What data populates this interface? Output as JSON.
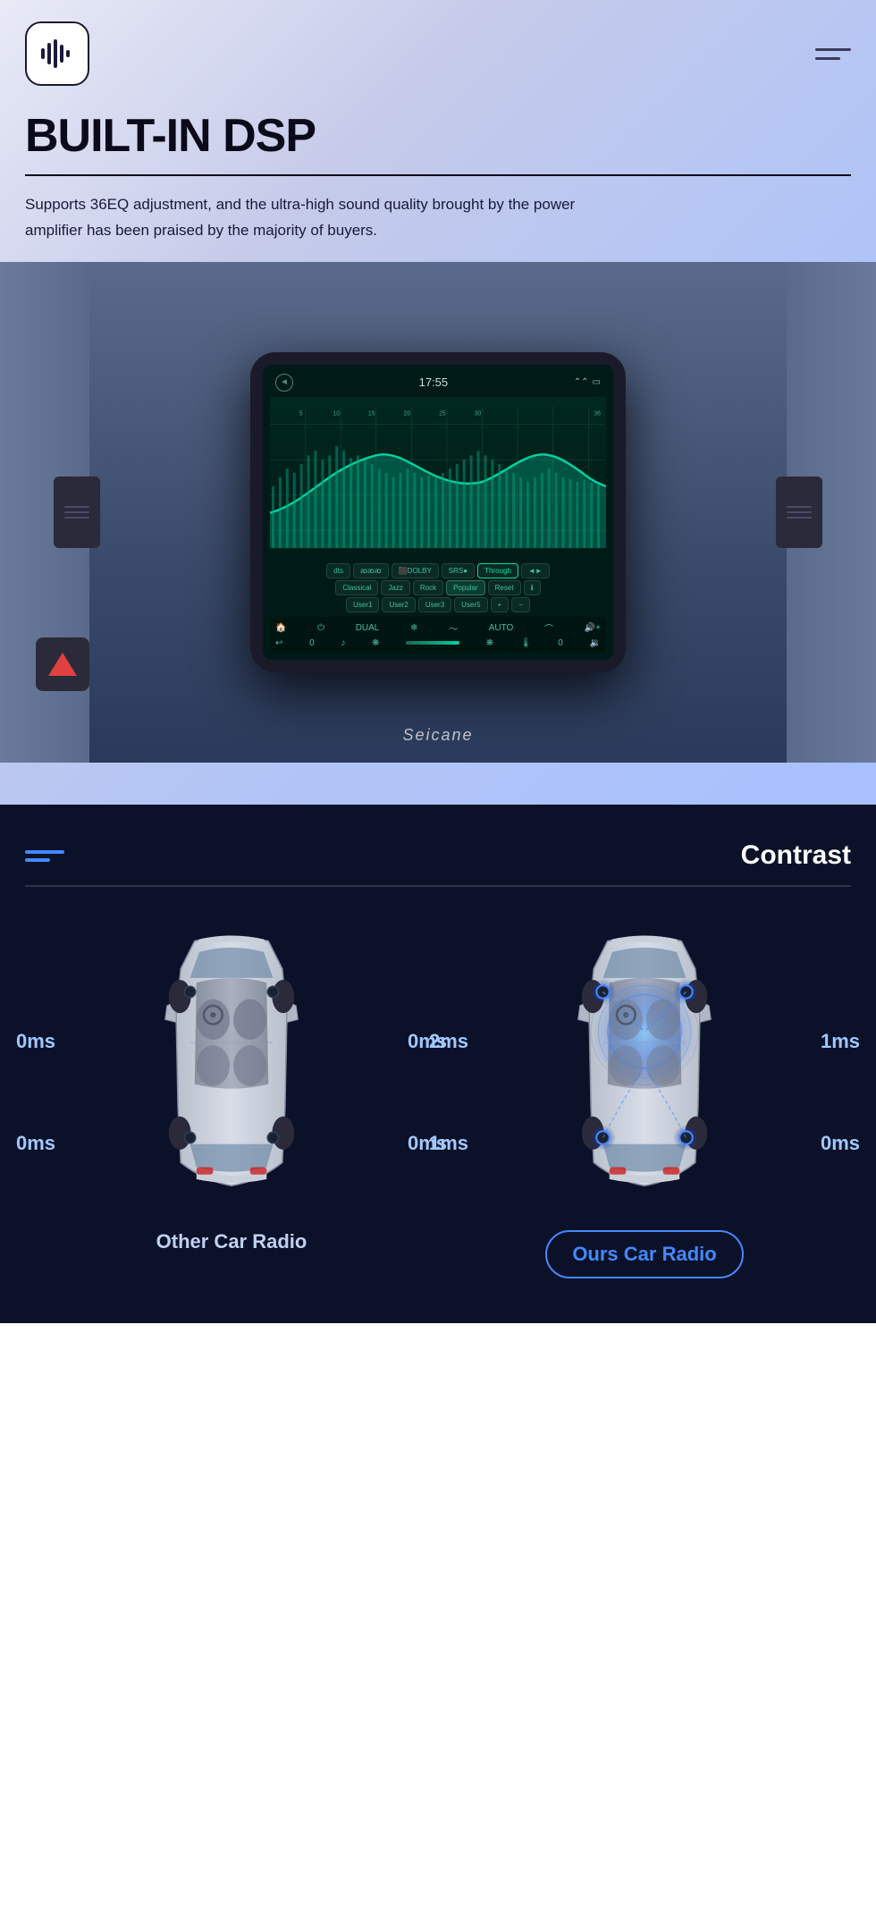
{
  "app": {
    "logo_alt": "Sound Wave Logo"
  },
  "header": {
    "title": "BUILT-IN DSP",
    "subtitle": "Supports 36EQ adjustment, and the ultra-high sound quality brought by the power amplifier has been praised by the majority of buyers."
  },
  "device": {
    "time": "17:55",
    "brand": "Seicane",
    "screen": {
      "dsp_buttons_row1": [
        "dts",
        "BBE",
        "DOLBY",
        "SRS●",
        "Through",
        "◄►"
      ],
      "dsp_buttons_row2": [
        "Classical",
        "Jazz",
        "Rock",
        "Popular",
        "Reset",
        "ℹ"
      ],
      "dsp_buttons_row3": [
        "User1",
        "User2",
        "User3",
        "User5",
        "+",
        "-"
      ]
    }
  },
  "contrast": {
    "title": "Contrast",
    "section_header_lines": 2,
    "other_car": {
      "label": "Other Car Radio",
      "delays": {
        "top_left": "0ms",
        "top_right": "0ms",
        "bottom_left": "0ms",
        "bottom_right": "0ms"
      }
    },
    "ours_car": {
      "label": "Ours Car Radio",
      "delays": {
        "top_left": "2ms",
        "top_right": "1ms",
        "bottom_left": "1ms",
        "bottom_right": "0ms"
      }
    }
  }
}
